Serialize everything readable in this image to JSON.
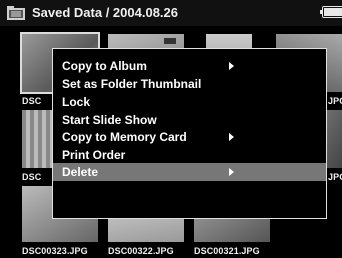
{
  "title": "Saved Data / 2004.08.26",
  "menu": {
    "items": [
      {
        "label": "Copy to Album",
        "submenu": true
      },
      {
        "label": "Set as Folder Thumbnail",
        "submenu": false
      },
      {
        "label": "Lock",
        "submenu": false
      },
      {
        "label": "Start Slide Show",
        "submenu": false
      },
      {
        "label": "Copy to Memory Card",
        "submenu": true
      },
      {
        "label": "Print Order",
        "submenu": false
      },
      {
        "label": "Delete",
        "submenu": true,
        "highlighted": true
      }
    ]
  },
  "thumbnails": {
    "row1": [
      "DSC",
      "JPG"
    ],
    "row2": [
      "DSC",
      "JPG"
    ],
    "row3": [
      "DSC00323.JPG",
      "DSC00322.JPG",
      "DSC00321.JPG"
    ]
  },
  "icons": {
    "folder": "folder-icon",
    "battery": "battery-icon",
    "submenu_arrow": "chevron-right-icon"
  },
  "colors": {
    "background": "#000000",
    "highlight": "#777777",
    "text": "#ffffff"
  }
}
